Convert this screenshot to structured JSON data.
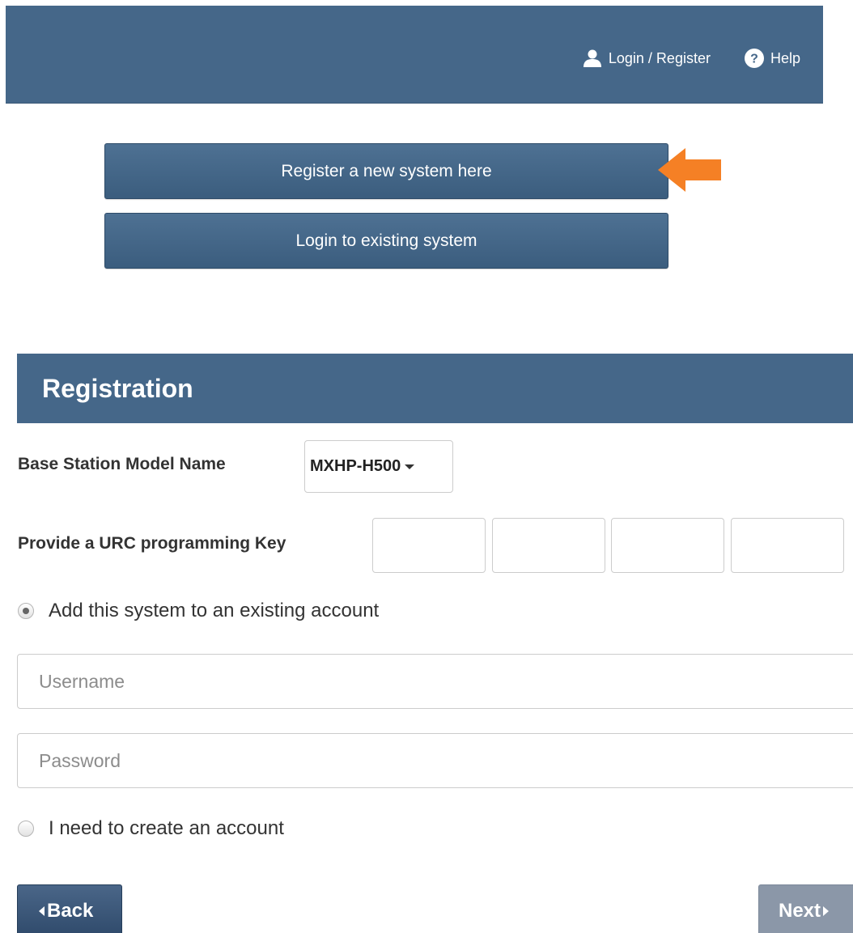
{
  "topnav": {
    "login_register": "Login / Register",
    "help": "Help"
  },
  "buttons": {
    "register_new": "Register a new system here",
    "login_existing": "Login to existing system"
  },
  "registration": {
    "title": "Registration",
    "model_label": "Base Station Model Name",
    "model_value": "MXHP-H500",
    "key_label": "Provide a URC programming Key",
    "key_fields": [
      "",
      "",
      "",
      ""
    ],
    "option_existing": "Add this system to an existing account",
    "option_existing_selected": true,
    "username_placeholder": "Username",
    "password_placeholder": "Password",
    "option_create": "I need to create an account",
    "option_create_selected": false
  },
  "footer": {
    "back": "Back",
    "next": "Next"
  },
  "colors": {
    "header_bg": "#456789",
    "button_bg": "#3b5d7e",
    "arrow": "#f58025",
    "next_disabled": "#8b97a8"
  },
  "icons": {
    "user": "user-icon",
    "help": "question-circle-icon",
    "pointer": "arrow-left-icon"
  }
}
